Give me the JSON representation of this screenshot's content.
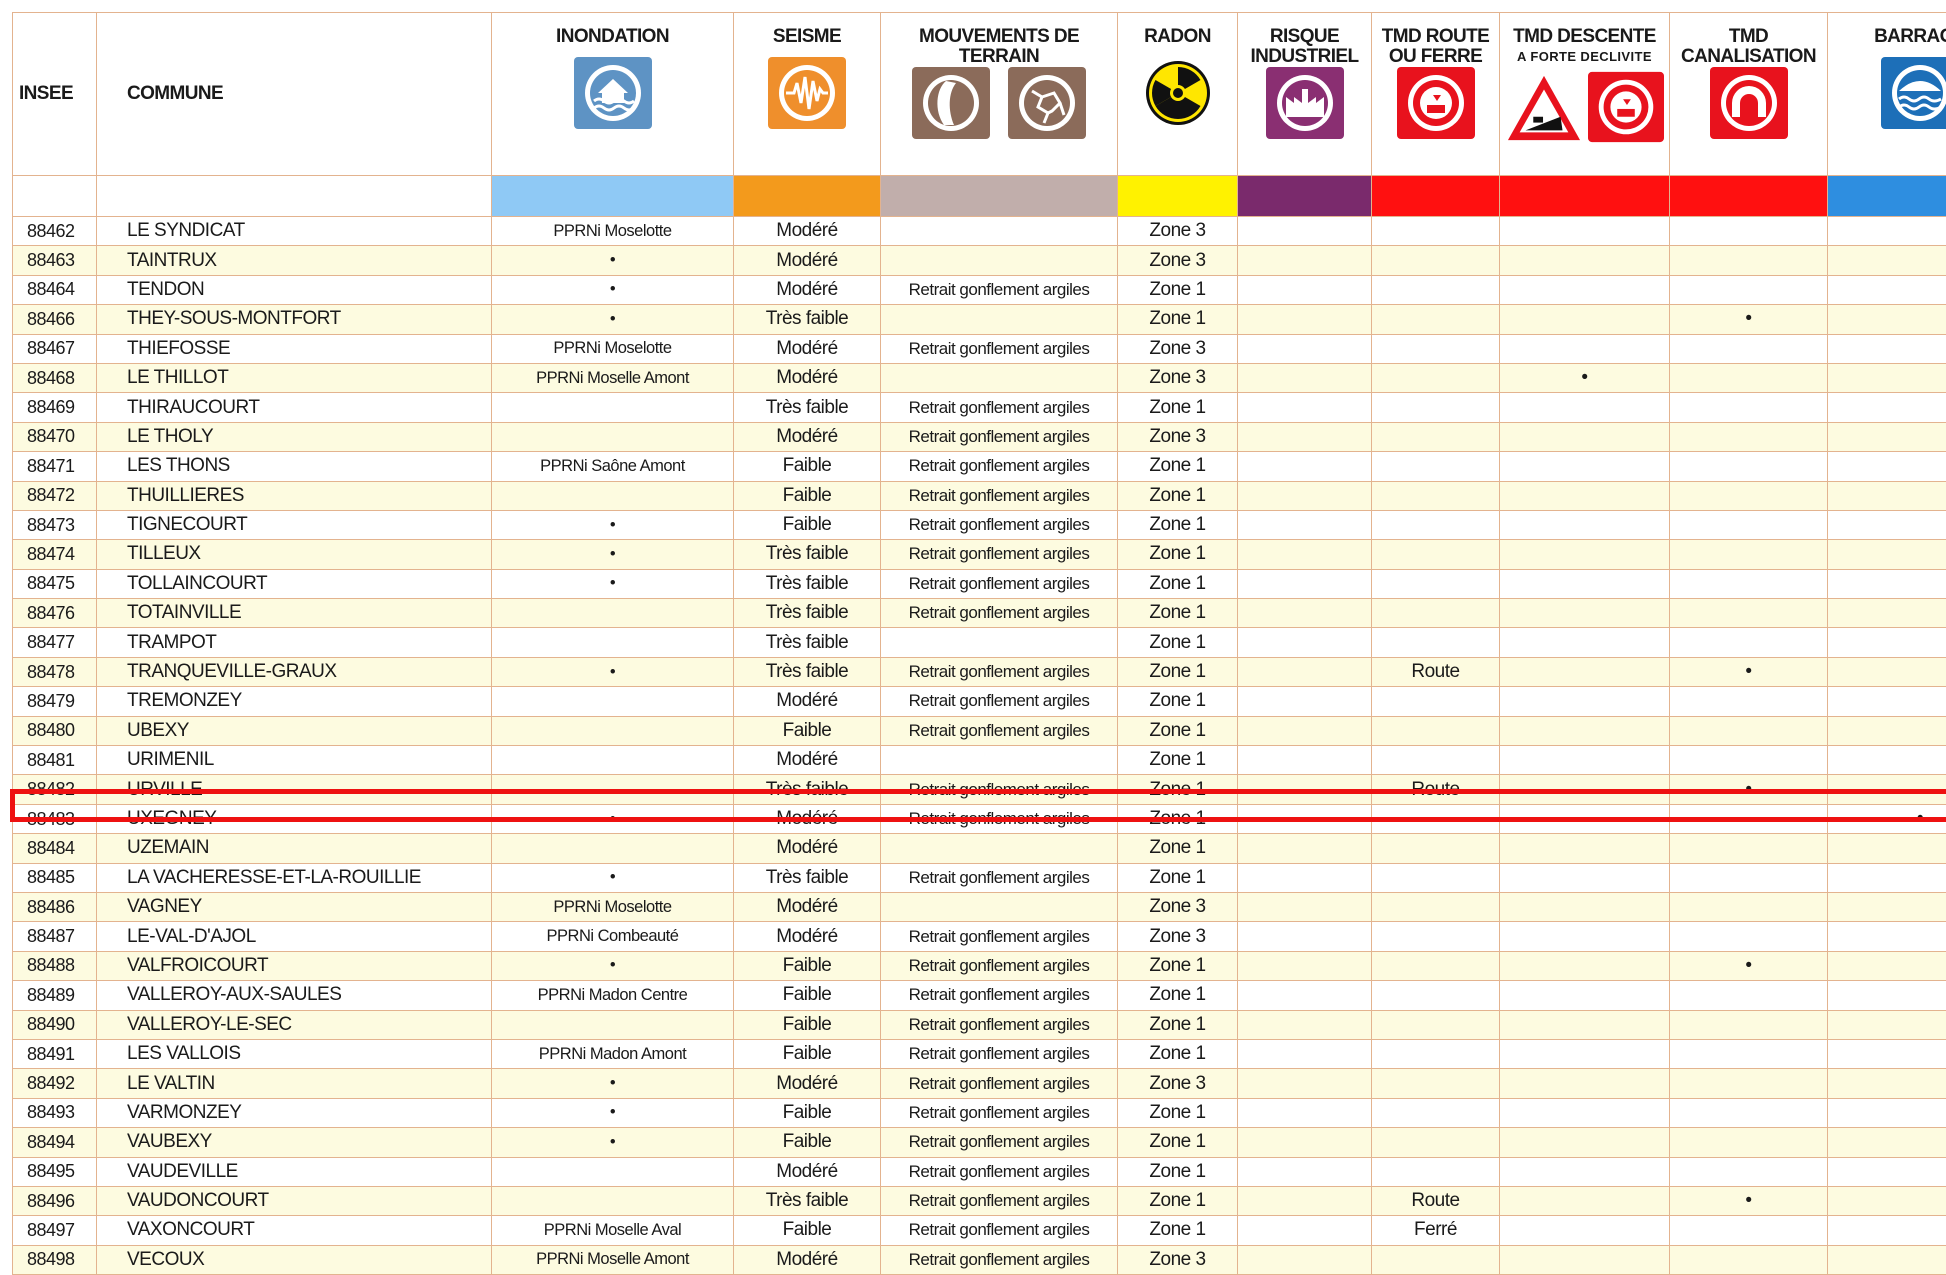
{
  "headers": {
    "insee": "INSEE",
    "commune": "COMMUNE",
    "inondation": "INONDATION",
    "seisme": "SEISME",
    "mouvements_line1": "MOUVEMENTS DE",
    "mouvements_line2": "TERRAIN",
    "radon": "RADON",
    "risque_line1": "RISQUE",
    "risque_line2": "INDUSTRIEL",
    "tmd_route_line1": "TMD  ROUTE",
    "tmd_route_line2": "OU FERRE",
    "tmd_descente_line1": "TMD DESCENTE",
    "tmd_descente_line2": "A FORTE DECLIVITE",
    "tmd_canal_line1": "TMD",
    "tmd_canal_line2": "CANALISATION",
    "barrage": "BARRAGE"
  },
  "icons": {
    "inondation": "flood-icon",
    "seisme": "earthquake-icon",
    "mouvements_1": "rockfall-icon",
    "mouvements_2": "ground-crack-icon",
    "radon": "radiation-icon",
    "risque": "industrial-factory-icon",
    "tmd_route": "hazmat-truck-icon",
    "tmd_descente_1": "steep-slope-warning-icon",
    "tmd_descente_2": "hazmat-truck-icon",
    "tmd_canal": "pipeline-icon",
    "barrage": "dam-icon"
  },
  "colors": {
    "inondation": "#8fc9f5",
    "seisme": "#f39a1c",
    "mouvements": "#c1aeab",
    "radon": "#fff200",
    "risque": "#7a2a6c",
    "tmd": "#ff1010",
    "barrage": "#2e8ee0",
    "highlight": "#ee1111"
  },
  "rows": [
    {
      "insee": "88462",
      "commune": "LE SYNDICAT",
      "inondation": "PPRNi Moselotte",
      "seisme": "Modéré",
      "mouvements": "",
      "radon": "Zone 3",
      "risque": "",
      "tmd_route": "",
      "tmd_descente": "",
      "tmd_canal": "",
      "barrage": ""
    },
    {
      "insee": "88463",
      "commune": "TAINTRUX",
      "inondation": "•",
      "seisme": "Modéré",
      "mouvements": "",
      "radon": "Zone 3",
      "risque": "",
      "tmd_route": "",
      "tmd_descente": "",
      "tmd_canal": "",
      "barrage": ""
    },
    {
      "insee": "88464",
      "commune": "TENDON",
      "inondation": "•",
      "seisme": "Modéré",
      "mouvements": "Retrait gonflement argiles",
      "radon": "Zone 1",
      "risque": "",
      "tmd_route": "",
      "tmd_descente": "",
      "tmd_canal": "",
      "barrage": ""
    },
    {
      "insee": "88466",
      "commune": "THEY-SOUS-MONTFORT",
      "inondation": "•",
      "seisme": "Très faible",
      "mouvements": "",
      "radon": "Zone 1",
      "risque": "",
      "tmd_route": "",
      "tmd_descente": "",
      "tmd_canal": "•",
      "barrage": ""
    },
    {
      "insee": "88467",
      "commune": "THIEFOSSE",
      "inondation": "PPRNi Moselotte",
      "seisme": "Modéré",
      "mouvements": "Retrait gonflement argiles",
      "radon": "Zone 3",
      "risque": "",
      "tmd_route": "",
      "tmd_descente": "",
      "tmd_canal": "",
      "barrage": ""
    },
    {
      "insee": "88468",
      "commune": "LE THILLOT",
      "inondation": "PPRNi Moselle Amont",
      "seisme": "Modéré",
      "mouvements": "",
      "radon": "Zone 3",
      "risque": "",
      "tmd_route": "",
      "tmd_descente": "•",
      "tmd_canal": "",
      "barrage": ""
    },
    {
      "insee": "88469",
      "commune": "THIRAUCOURT",
      "inondation": "",
      "seisme": "Très faible",
      "mouvements": "Retrait gonflement argiles",
      "radon": "Zone 1",
      "risque": "",
      "tmd_route": "",
      "tmd_descente": "",
      "tmd_canal": "",
      "barrage": ""
    },
    {
      "insee": "88470",
      "commune": "LE THOLY",
      "inondation": "",
      "seisme": "Modéré",
      "mouvements": "Retrait gonflement argiles",
      "radon": "Zone 3",
      "risque": "",
      "tmd_route": "",
      "tmd_descente": "",
      "tmd_canal": "",
      "barrage": ""
    },
    {
      "insee": "88471",
      "commune": "LES THONS",
      "inondation": "PPRNi Saône Amont",
      "seisme": "Faible",
      "mouvements": "Retrait gonflement argiles",
      "radon": "Zone 1",
      "risque": "",
      "tmd_route": "",
      "tmd_descente": "",
      "tmd_canal": "",
      "barrage": ""
    },
    {
      "insee": "88472",
      "commune": "THUILLIERES",
      "inondation": "",
      "seisme": "Faible",
      "mouvements": "Retrait gonflement argiles",
      "radon": "Zone 1",
      "risque": "",
      "tmd_route": "",
      "tmd_descente": "",
      "tmd_canal": "",
      "barrage": ""
    },
    {
      "insee": "88473",
      "commune": "TIGNECOURT",
      "inondation": "•",
      "seisme": "Faible",
      "mouvements": "Retrait gonflement argiles",
      "radon": "Zone 1",
      "risque": "",
      "tmd_route": "",
      "tmd_descente": "",
      "tmd_canal": "",
      "barrage": ""
    },
    {
      "insee": "88474",
      "commune": "TILLEUX",
      "inondation": "•",
      "seisme": "Très faible",
      "mouvements": "Retrait gonflement argiles",
      "radon": "Zone 1",
      "risque": "",
      "tmd_route": "",
      "tmd_descente": "",
      "tmd_canal": "",
      "barrage": ""
    },
    {
      "insee": "88475",
      "commune": "TOLLAINCOURT",
      "inondation": "•",
      "seisme": "Très faible",
      "mouvements": "Retrait gonflement argiles",
      "radon": "Zone 1",
      "risque": "",
      "tmd_route": "",
      "tmd_descente": "",
      "tmd_canal": "",
      "barrage": ""
    },
    {
      "insee": "88476",
      "commune": "TOTAINVILLE",
      "inondation": "",
      "seisme": "Très faible",
      "mouvements": "Retrait gonflement argiles",
      "radon": "Zone 1",
      "risque": "",
      "tmd_route": "",
      "tmd_descente": "",
      "tmd_canal": "",
      "barrage": ""
    },
    {
      "insee": "88477",
      "commune": "TRAMPOT",
      "inondation": "",
      "seisme": "Très faible",
      "mouvements": "",
      "radon": "Zone 1",
      "risque": "",
      "tmd_route": "",
      "tmd_descente": "",
      "tmd_canal": "",
      "barrage": ""
    },
    {
      "insee": "88478",
      "commune": "TRANQUEVILLE-GRAUX",
      "inondation": "•",
      "seisme": "Très faible",
      "mouvements": "Retrait gonflement argiles",
      "radon": "Zone 1",
      "risque": "",
      "tmd_route": "Route",
      "tmd_descente": "",
      "tmd_canal": "•",
      "barrage": ""
    },
    {
      "insee": "88479",
      "commune": "TREMONZEY",
      "inondation": "",
      "seisme": "Modéré",
      "mouvements": "Retrait gonflement argiles",
      "radon": "Zone 1",
      "risque": "",
      "tmd_route": "",
      "tmd_descente": "",
      "tmd_canal": "",
      "barrage": ""
    },
    {
      "insee": "88480",
      "commune": "UBEXY",
      "inondation": "",
      "seisme": "Faible",
      "mouvements": "Retrait gonflement argiles",
      "radon": "Zone 1",
      "risque": "",
      "tmd_route": "",
      "tmd_descente": "",
      "tmd_canal": "",
      "barrage": ""
    },
    {
      "insee": "88481",
      "commune": "URIMENIL",
      "inondation": "",
      "seisme": "Modéré",
      "mouvements": "",
      "radon": "Zone 1",
      "risque": "",
      "tmd_route": "",
      "tmd_descente": "",
      "tmd_canal": "",
      "barrage": ""
    },
    {
      "insee": "88482",
      "commune": "URVILLE",
      "inondation": "",
      "seisme": "Très faible",
      "mouvements": "Retrait gonflement argiles",
      "radon": "Zone 1",
      "risque": "",
      "tmd_route": "Route",
      "tmd_descente": "",
      "tmd_canal": "•",
      "barrage": ""
    },
    {
      "insee": "88483",
      "commune": "UXEGNEY",
      "inondation": "•",
      "seisme": "Modéré",
      "mouvements": "Retrait gonflement argiles",
      "radon": "Zone 1",
      "risque": "",
      "tmd_route": "",
      "tmd_descente": "",
      "tmd_canal": "",
      "barrage": "•"
    },
    {
      "insee": "88484",
      "commune": "UZEMAIN",
      "inondation": "",
      "seisme": "Modéré",
      "mouvements": "",
      "radon": "Zone 1",
      "risque": "",
      "tmd_route": "",
      "tmd_descente": "",
      "tmd_canal": "",
      "barrage": ""
    },
    {
      "insee": "88485",
      "commune": "LA VACHERESSE-ET-LA-ROUILLIE",
      "inondation": "•",
      "seisme": "Très faible",
      "mouvements": "Retrait gonflement argiles",
      "radon": "Zone 1",
      "risque": "",
      "tmd_route": "",
      "tmd_descente": "",
      "tmd_canal": "",
      "barrage": ""
    },
    {
      "insee": "88486",
      "commune": "VAGNEY",
      "inondation": "PPRNi Moselotte",
      "seisme": "Modéré",
      "mouvements": "",
      "radon": "Zone 3",
      "risque": "",
      "tmd_route": "",
      "tmd_descente": "",
      "tmd_canal": "",
      "barrage": ""
    },
    {
      "insee": "88487",
      "commune": "LE-VAL-D'AJOL",
      "inondation": "PPRNi Combeauté",
      "seisme": "Modéré",
      "mouvements": "Retrait gonflement argiles",
      "radon": "Zone 3",
      "risque": "",
      "tmd_route": "",
      "tmd_descente": "",
      "tmd_canal": "",
      "barrage": ""
    },
    {
      "insee": "88488",
      "commune": "VALFROICOURT",
      "inondation": "•",
      "seisme": "Faible",
      "mouvements": "Retrait gonflement argiles",
      "radon": "Zone 1",
      "risque": "",
      "tmd_route": "",
      "tmd_descente": "",
      "tmd_canal": "•",
      "barrage": ""
    },
    {
      "insee": "88489",
      "commune": "VALLEROY-AUX-SAULES",
      "inondation": "PPRNi Madon Centre",
      "seisme": "Faible",
      "mouvements": "Retrait gonflement argiles",
      "radon": "Zone 1",
      "risque": "",
      "tmd_route": "",
      "tmd_descente": "",
      "tmd_canal": "",
      "barrage": ""
    },
    {
      "insee": "88490",
      "commune": "VALLEROY-LE-SEC",
      "inondation": "",
      "seisme": "Faible",
      "mouvements": "Retrait gonflement argiles",
      "radon": "Zone 1",
      "risque": "",
      "tmd_route": "",
      "tmd_descente": "",
      "tmd_canal": "",
      "barrage": ""
    },
    {
      "insee": "88491",
      "commune": "LES VALLOIS",
      "inondation": "PPRNi Madon Amont",
      "seisme": "Faible",
      "mouvements": "Retrait gonflement argiles",
      "radon": "Zone 1",
      "risque": "",
      "tmd_route": "",
      "tmd_descente": "",
      "tmd_canal": "",
      "barrage": ""
    },
    {
      "insee": "88492",
      "commune": "LE VALTIN",
      "inondation": "•",
      "seisme": "Modéré",
      "mouvements": "Retrait gonflement argiles",
      "radon": "Zone 3",
      "risque": "",
      "tmd_route": "",
      "tmd_descente": "",
      "tmd_canal": "",
      "barrage": ""
    },
    {
      "insee": "88493",
      "commune": "VARMONZEY",
      "inondation": "•",
      "seisme": "Faible",
      "mouvements": "Retrait gonflement argiles",
      "radon": "Zone 1",
      "risque": "",
      "tmd_route": "",
      "tmd_descente": "",
      "tmd_canal": "",
      "barrage": ""
    },
    {
      "insee": "88494",
      "commune": "VAUBEXY",
      "inondation": "•",
      "seisme": "Faible",
      "mouvements": "Retrait gonflement argiles",
      "radon": "Zone 1",
      "risque": "",
      "tmd_route": "",
      "tmd_descente": "",
      "tmd_canal": "",
      "barrage": ""
    },
    {
      "insee": "88495",
      "commune": "VAUDEVILLE",
      "inondation": "",
      "seisme": "Modéré",
      "mouvements": "Retrait gonflement argiles",
      "radon": "Zone 1",
      "risque": "",
      "tmd_route": "",
      "tmd_descente": "",
      "tmd_canal": "",
      "barrage": ""
    },
    {
      "insee": "88496",
      "commune": "VAUDONCOURT",
      "inondation": "",
      "seisme": "Très faible",
      "mouvements": "Retrait gonflement argiles",
      "radon": "Zone 1",
      "risque": "",
      "tmd_route": "Route",
      "tmd_descente": "",
      "tmd_canal": "•",
      "barrage": ""
    },
    {
      "insee": "88497",
      "commune": "VAXONCOURT",
      "inondation": "PPRNi Moselle Aval",
      "seisme": "Faible",
      "mouvements": "Retrait gonflement argiles",
      "radon": "Zone 1",
      "risque": "",
      "tmd_route": "Ferré",
      "tmd_descente": "",
      "tmd_canal": "",
      "barrage": ""
    },
    {
      "insee": "88498",
      "commune": "VECOUX",
      "inondation": "PPRNi Moselle Amont",
      "seisme": "Modéré",
      "mouvements": "Retrait gonflement argiles",
      "radon": "Zone 3",
      "risque": "",
      "tmd_route": "",
      "tmd_descente": "",
      "tmd_canal": "",
      "barrage": ""
    }
  ]
}
